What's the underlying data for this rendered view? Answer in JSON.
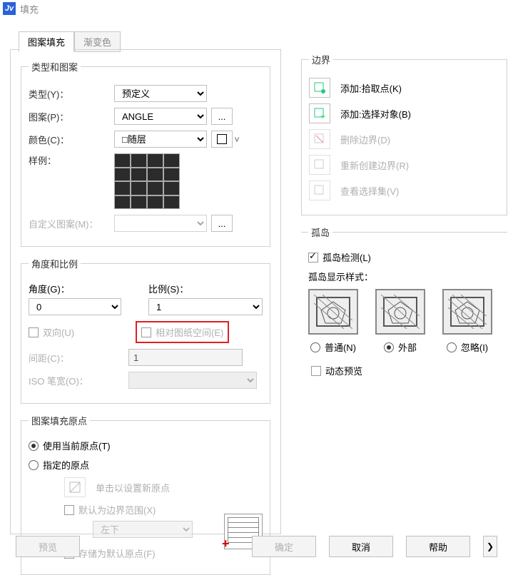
{
  "titlebar": {
    "title": "填充"
  },
  "tabs": {
    "t1": "图案填充",
    "t2": "渐变色"
  },
  "group1": {
    "legend": "类型和图案",
    "type_label": "类型(Y)：",
    "type_value": "预定义",
    "pattern_label": "图案(P)：",
    "pattern_value": "ANGLE",
    "ellipsis": "...",
    "color_label": "颜色(C)：",
    "color_value": "□随层",
    "sample_label": "样例：",
    "custom_label": "自定义图案(M)："
  },
  "group2": {
    "legend": "角度和比例",
    "angle_label": "角度(G)：",
    "angle_value": "0",
    "scale_label": "比例(S)：",
    "scale_value": "1",
    "biway": "双向(U)",
    "relative": "相对图纸空间(E)",
    "spacing_label": "间距(C)：",
    "spacing_value": "1",
    "iso_label": "ISO 笔宽(O)："
  },
  "group3": {
    "legend": "图案填充原点",
    "r1": "使用当前原点(T)",
    "r2": "指定的原点",
    "click_set": "单击以设置新原点",
    "default_ext": "默认为边界范围(X)",
    "dir_value": "左下",
    "store": "存储为默认原点(F)"
  },
  "boundary": {
    "legend": "边界",
    "add_pick": "添加:拾取点(K)",
    "add_sel": "添加:选择对象(B)",
    "del": "删除边界(D)",
    "recreate": "重新创建边界(R)",
    "view": "查看选择集(V)"
  },
  "island": {
    "legend": "孤岛",
    "detect": "孤岛检测(L)",
    "style": "孤岛显示样式：",
    "o1": "普通(N)",
    "o2": "外部",
    "o3": "忽略(I)"
  },
  "dynamic": "动态预览",
  "footer": {
    "preview": "预览",
    "ok": "确定",
    "cancel": "取消",
    "help": "帮助"
  }
}
